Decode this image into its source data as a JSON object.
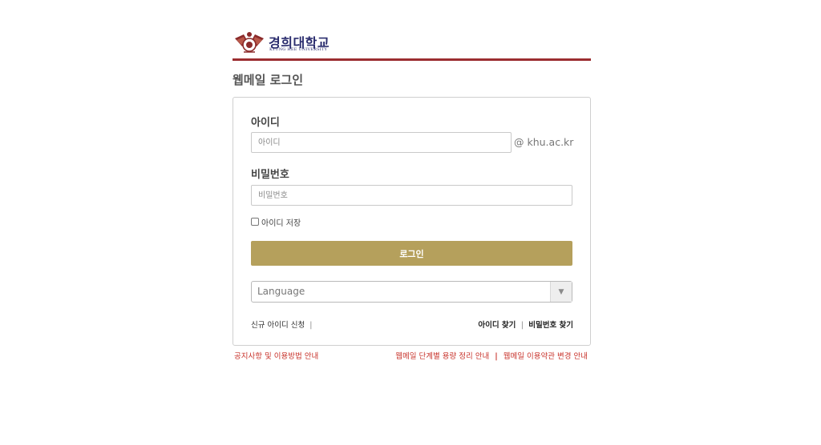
{
  "brand": {
    "name_kr": "경희대학교",
    "name_en": "KYUNG HEE UNIVERSITY",
    "rule_color": "#9b2d30",
    "logo_icon": "university-emblem-icon"
  },
  "page": {
    "title": "웹메일 로그인"
  },
  "login": {
    "id_label": "아이디",
    "id_placeholder": "아이디",
    "domain": "@ khu.ac.kr",
    "pw_label": "비밀번호",
    "pw_placeholder": "비밀번호",
    "remember_label": "아이디 저장",
    "remember_checked": false,
    "login_button": "로그인",
    "button_color": "#b5a05c",
    "language_select": "Language",
    "dropdown_icon": "triangle-down-icon"
  },
  "links": {
    "signup": "신규 아이디 신청",
    "signup_sep": "|",
    "find_id": "아이디 찾기",
    "find_sep": "|",
    "find_pw": "비밀번호 찾기"
  },
  "footer": {
    "notice": "공지사항 및 이용방법 안내",
    "capacity": "웹메일 단계별 용량 정리 안내",
    "sep": "|",
    "terms": "웹메일 이용약관 변경 안내",
    "link_color": "#c8332b"
  }
}
